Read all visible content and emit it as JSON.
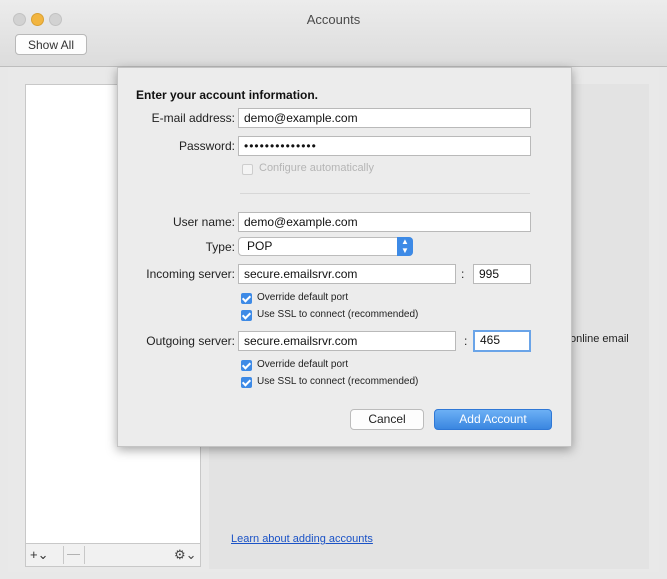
{
  "window": {
    "title": "Accounts",
    "show_all_label": "Show All"
  },
  "sheet": {
    "heading": "Enter your account information.",
    "email": {
      "label": "E-mail address:",
      "value": "demo@example.com"
    },
    "password": {
      "label": "Password:",
      "value": "••••••••••••••"
    },
    "configure_auto": {
      "label": "Configure automatically",
      "checked": false,
      "enabled": false
    },
    "username": {
      "label": "User name:",
      "value": "demo@example.com"
    },
    "type": {
      "label": "Type:",
      "value": "POP"
    },
    "incoming": {
      "label": "Incoming server:",
      "server": "secure.emailsrvr.com",
      "colon": ":",
      "port": "995",
      "override_port": {
        "label": "Override default port",
        "checked": true
      },
      "use_ssl": {
        "label": "Use SSL to connect (recommended)",
        "checked": true
      }
    },
    "outgoing": {
      "label": "Outgoing server:",
      "server": "secure.emailsrvr.com",
      "colon": ":",
      "port": "465",
      "override_port": {
        "label": "Override default port",
        "checked": true
      },
      "use_ssl": {
        "label": "Use SSL to connect (recommended)",
        "checked": true
      }
    },
    "cancel_label": "Cancel",
    "add_account_label": "Add Account"
  },
  "sidebar": {
    "add_label": "+⌄",
    "remove_label": "—",
    "gear_label": "⚙⌄"
  },
  "pane": {
    "online_email_text": "online email",
    "learn_link": "Learn about adding accounts"
  },
  "colors": {
    "accent": "#3d8ae6",
    "link": "#1a52c6"
  }
}
